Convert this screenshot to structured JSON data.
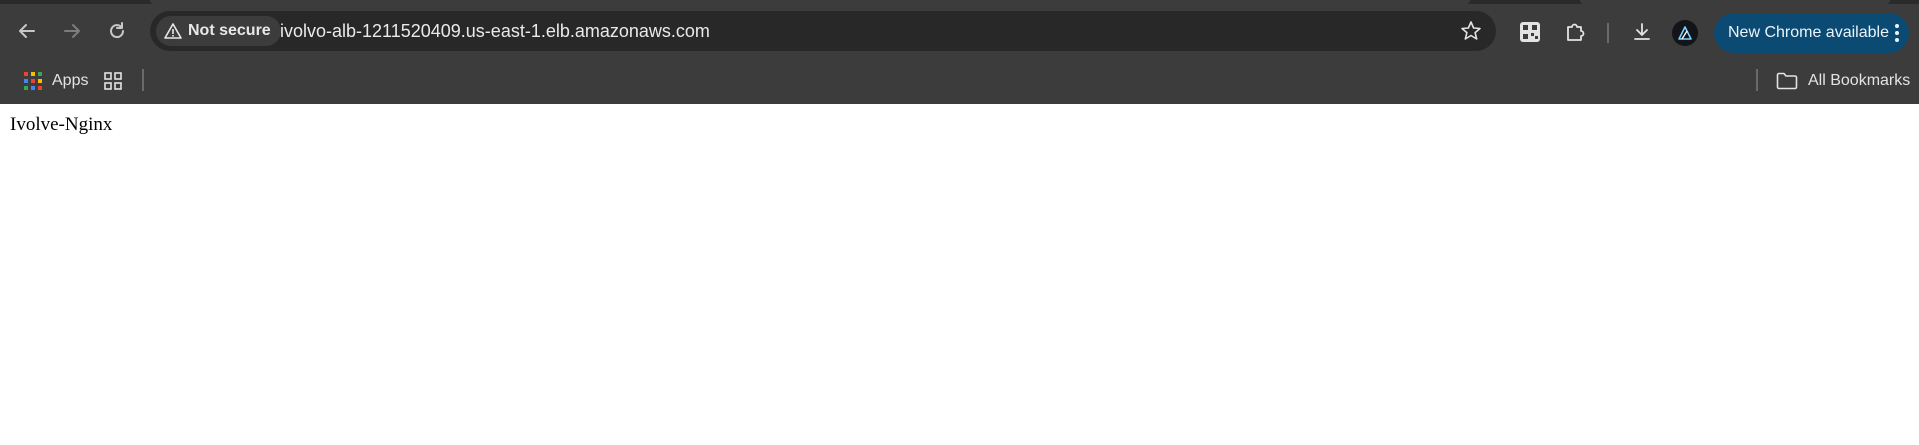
{
  "window": {
    "colors": {
      "chrome_bg": "#3c3c3c",
      "omnibox_bg": "#282828",
      "update_pill_bg": "#0b4a73",
      "page_bg": "#ffffff"
    }
  },
  "toolbar": {
    "back_icon": "arrow-left-icon",
    "forward_icon": "arrow-right-icon",
    "reload_icon": "reload-icon",
    "security_label": "Not secure",
    "security_icon": "warning-triangle-icon",
    "url": "ivolvo-alb-1211520409.us-east-1.elb.amazonaws.com",
    "bookmark_star_icon": "star-outline-icon",
    "qr_icon": "qr-code-icon",
    "extensions_icon": "puzzle-piece-icon",
    "downloads_icon": "download-icon",
    "profile_icon": "profile-avatar-icon",
    "update_label": "New Chrome available",
    "menu_icon": "three-dots-vertical-icon"
  },
  "bookmarks": {
    "apps_label": "Apps",
    "apps_icon": "apps-grid-icon",
    "tab_groups_icon": "tab-groups-icon",
    "all_bookmarks_label": "All Bookmarks",
    "all_bookmarks_icon": "folder-icon"
  },
  "page": {
    "body_text": "Ivolve-Nginx"
  }
}
